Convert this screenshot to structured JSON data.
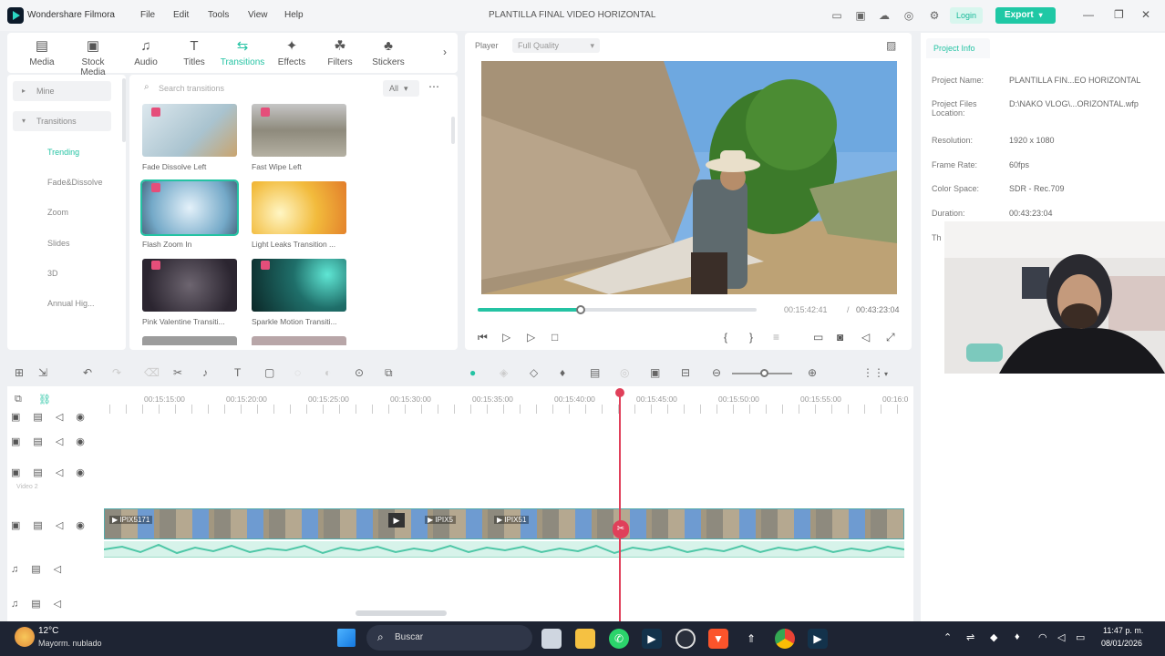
{
  "app": {
    "name": "Wondershare Filmora",
    "project_title": "PLANTILLA FINAL VIDEO HORIZONTAL"
  },
  "menu": [
    "File",
    "Edit",
    "Tools",
    "View",
    "Help"
  ],
  "header": {
    "login_label": "Login",
    "export_label": "Export"
  },
  "media_tabs": [
    {
      "label": "Media",
      "icon": "media-icon"
    },
    {
      "label": "Stock Media",
      "icon": "stock-media-icon"
    },
    {
      "label": "Audio",
      "icon": "music-note-icon"
    },
    {
      "label": "Titles",
      "icon": "text-icon"
    },
    {
      "label": "Transitions",
      "icon": "transitions-icon"
    },
    {
      "label": "Effects",
      "icon": "effects-icon"
    },
    {
      "label": "Filters",
      "icon": "filters-icon"
    },
    {
      "label": "Stickers",
      "icon": "stickers-icon"
    }
  ],
  "categories": {
    "mine": "Mine",
    "transitions": "Transitions",
    "items": [
      "Trending",
      "Fade&Dissolve",
      "Zoom",
      "Slides",
      "3D",
      "Annual Hig..."
    ]
  },
  "search": {
    "placeholder": "Search transitions",
    "filter": "All"
  },
  "transitions": [
    {
      "label": "Fade Dissolve Left"
    },
    {
      "label": "Fast Wipe Left"
    },
    {
      "label": "Flash Zoom In"
    },
    {
      "label": "Light Leaks Transition ..."
    },
    {
      "label": "Pink Valentine Transiti..."
    },
    {
      "label": "Sparkle Motion Transiti..."
    }
  ],
  "player": {
    "label": "Player",
    "quality": "Full Quality",
    "current_time": "00:15:42:41",
    "separator": "/",
    "total_time": "00:43:23:04",
    "progress": 0.36
  },
  "project_info": {
    "tab": "Project Info",
    "rows": [
      {
        "label": "Project Name:",
        "value": "PLANTILLA FIN...EO HORIZONTAL"
      },
      {
        "label": "Project Files Location:",
        "value": "D:\\NAKO VLOG\\...ORIZONTAL.wfp"
      },
      {
        "label": "Resolution:",
        "value": "1920 x 1080"
      },
      {
        "label": "Frame Rate:",
        "value": "60fps"
      },
      {
        "label": "Color Space:",
        "value": "SDR - Rec.709"
      },
      {
        "label": "Duration:",
        "value": "00:43:23:04"
      }
    ],
    "partial": "Th"
  },
  "timeline": {
    "ruler": [
      "00:15:15:00",
      "00:15:20:00",
      "00:15:25:00",
      "00:15:30:00",
      "00:15:35:00",
      "00:15:40:00",
      "00:15:45:00",
      "00:15:50:00",
      "00:15:55:00",
      "00:16:0"
    ],
    "video_label": "Video 2",
    "clips": [
      "IPIX5171",
      "IPIX5",
      "IPIX51"
    ]
  },
  "taskbar": {
    "weather_temp": "12°C",
    "weather_desc": "Mayorm. nublado",
    "search": "Buscar",
    "time": "11:47 p. m.",
    "date": "08/01/2026"
  },
  "colors": {
    "accent": "#24c3a3",
    "playhead": "#e0405a",
    "export": "#1fc8a5"
  }
}
